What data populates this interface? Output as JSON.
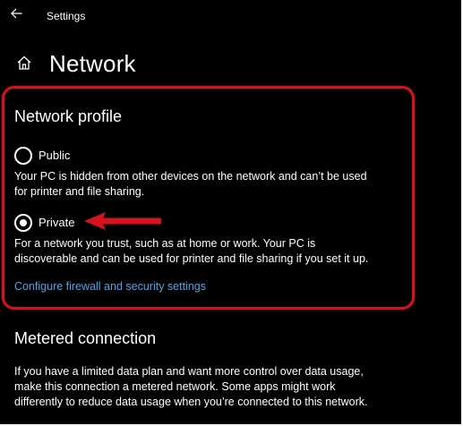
{
  "window": {
    "title": "Settings",
    "back_icon": "back-arrow-icon"
  },
  "page": {
    "title": "Network",
    "home_icon": "home-icon"
  },
  "network_profile": {
    "heading": "Network profile",
    "options": [
      {
        "label": "Public",
        "selected": false,
        "description_lines": [
          "Your PC is hidden from other devices on the network and can’t be used",
          "for printer and file sharing."
        ]
      },
      {
        "label": "Private",
        "selected": true,
        "description_lines": [
          "For a network you trust, such as at home or work. Your PC is",
          "discoverable and can be used for printer and file sharing if you set it up."
        ]
      }
    ],
    "link_text": "Configure firewall and security settings"
  },
  "metered": {
    "heading": "Metered connection",
    "description_lines": [
      "If you have a limited data plan and want more control over data usage,",
      "make this connection a metered network. Some apps might work",
      "differently to reduce data usage when you’re connected to this network."
    ]
  },
  "annotation": {
    "ring_color": "#d4141c",
    "arrow_color": "#d4141c",
    "arrow_target": "Private"
  },
  "theme": {
    "background": "#000000",
    "text": "#ffffff",
    "link": "#4ba3ee"
  }
}
